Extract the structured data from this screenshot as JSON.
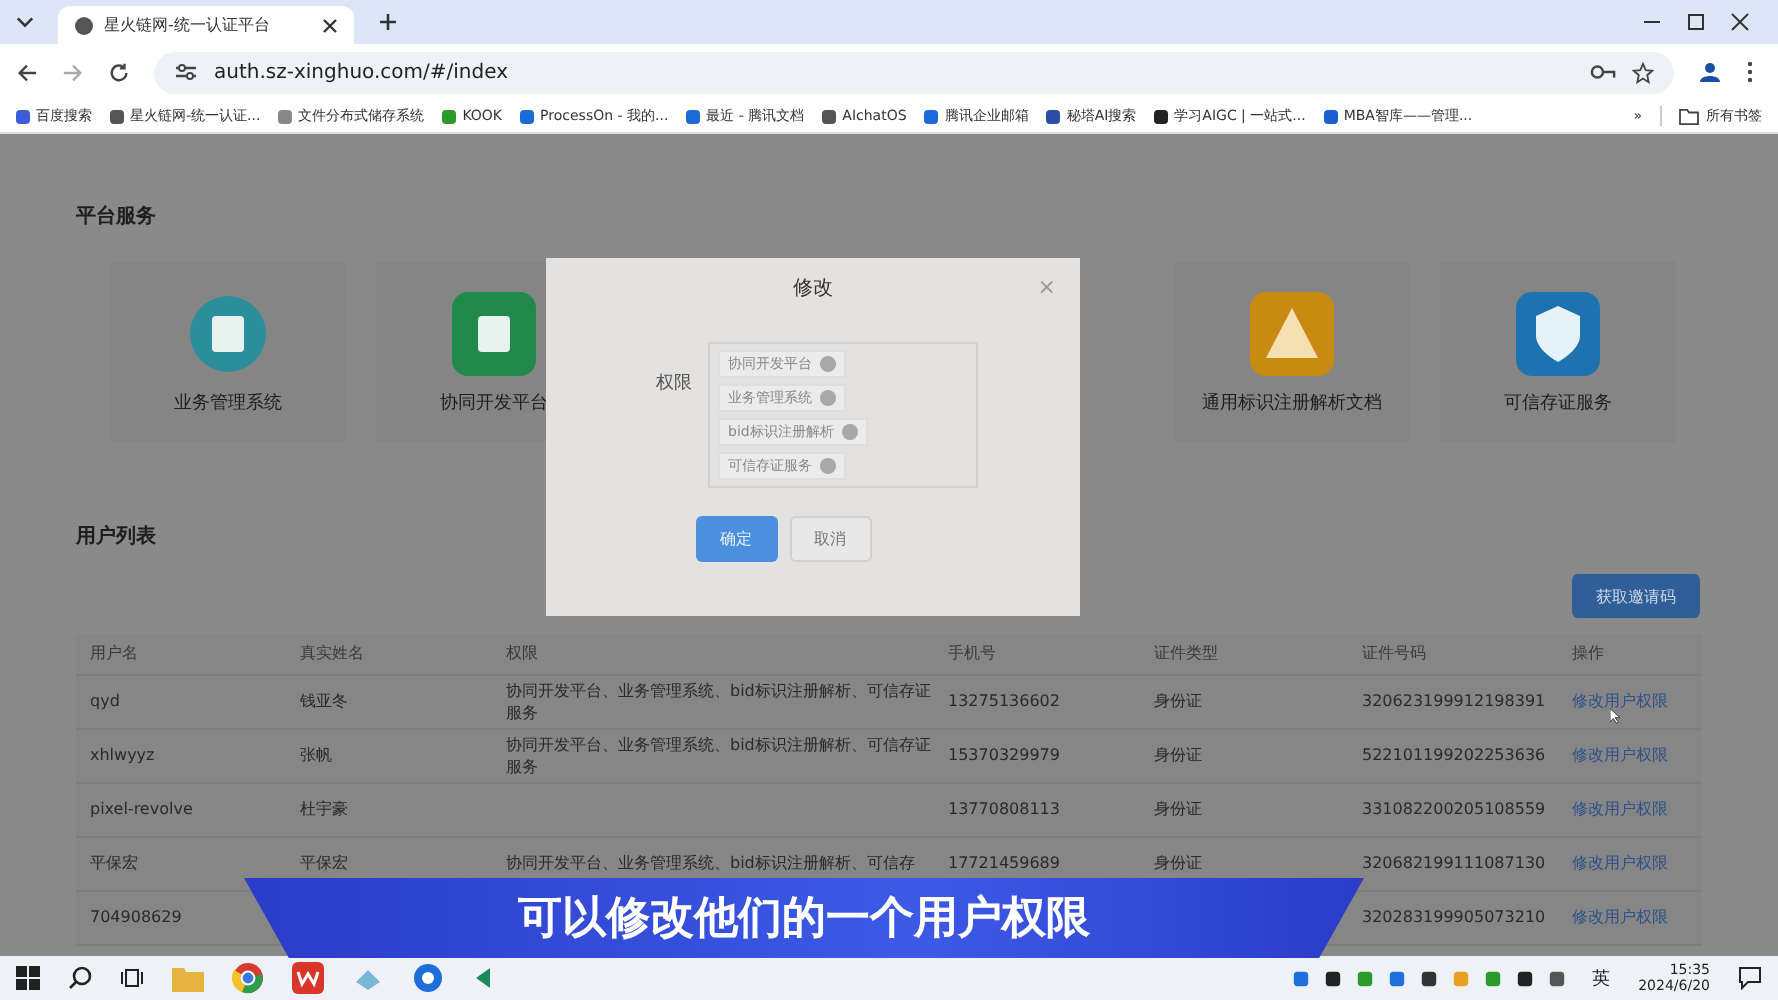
{
  "browser": {
    "tab_title": "星火链网-统一认证平台",
    "url": "auth.sz-xinghuo.com/#/index",
    "bookmarks": [
      "百度搜索",
      "星火链网-统一认证...",
      "文件分布式储存系统",
      "KOOK",
      "ProcessOn - 我的...",
      "最近 - 腾讯文档",
      "AIchatOS",
      "腾讯企业邮箱",
      "秘塔AI搜索",
      "学习AIGC | 一站式...",
      "MBA智库——管理..."
    ],
    "more": "»",
    "all_bookmarks": "所有书签"
  },
  "platform": {
    "title": "平台服务",
    "services": [
      {
        "label": "业务管理系统"
      },
      {
        "label": "协同开发平台"
      },
      {
        "label": "通用标识注册解析文档"
      },
      {
        "label": "可信存证服务"
      }
    ]
  },
  "users": {
    "title": "用户列表",
    "invite_button": "获取邀请码",
    "columns": [
      "用户名",
      "真实姓名",
      "权限",
      "手机号",
      "证件类型",
      "证件号码",
      "操作"
    ],
    "rows": [
      {
        "cells": [
          "qyd",
          "钱亚冬",
          "协同开发平台、业务管理系统、bid标识注册解析、可信存证服务",
          "13275136602",
          "身份证",
          "320623199912198391"
        ],
        "action": "修改用户权限"
      },
      {
        "cells": [
          "xhlwyyz",
          "张帆",
          "协同开发平台、业务管理系统、bid标识注册解析、可信存证服务",
          "15370329979",
          "身份证",
          "522101199202253636"
        ],
        "action": "修改用户权限"
      },
      {
        "cells": [
          "pixel-revolve",
          "杜宇豪",
          "",
          "13770808113",
          "身份证",
          "331082200205108559"
        ],
        "action": "修改用户权限"
      },
      {
        "cells": [
          "平保宏",
          "平保宏",
          "协同开发平台、业务管理系统、bid标识注册解析、可信存",
          "17721459689",
          "身份证",
          "320682199111087130"
        ],
        "action": "修改用户权限"
      },
      {
        "cells": [
          "704908629",
          "",
          "",
          "",
          "",
          "320283199905073210"
        ],
        "action": "修改用户权限"
      }
    ]
  },
  "dialog": {
    "title": "修改",
    "close": "×",
    "field_label": "权限",
    "tags": [
      "协同开发平台",
      "业务管理系统",
      "bid标识注册解析",
      "可信存证服务"
    ],
    "buttons": [
      {
        "label": "确定",
        "kind": "primary"
      },
      {
        "label": "取消",
        "kind": "default"
      }
    ]
  },
  "caption": "可以修改他们的一个用户权限",
  "taskbar": {
    "ime": "英",
    "time": "15:35",
    "date": "2024/6/20"
  }
}
